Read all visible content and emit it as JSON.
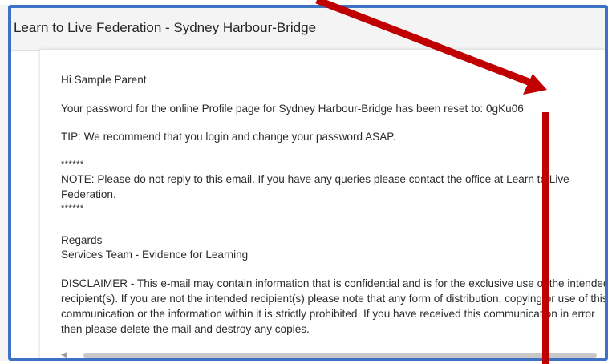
{
  "header": {
    "title": "Learn to Live Federation - Sydney Harbour-Bridge"
  },
  "email": {
    "greeting": "Hi Sample Parent",
    "password_line": "Your password for the online Profile page for Sydney Harbour-Bridge has been reset to: 0gKu06",
    "tip": "TIP: We recommend that you login and change your password ASAP.",
    "stars_top": "******",
    "note": "NOTE: Please do not reply to this email. If you have any queries please contact the office at Learn to Live Federation.",
    "stars_bottom": "******",
    "regards": "Regards",
    "signature": "Services Team - Evidence for Learning",
    "disclaimer": "DISCLAIMER - This e-mail may contain information that is confidential and is for the exclusive use of the intended recipient(s). If you are not the intended recipient(s) please note that any form of distribution, copying or use of this communication or the information within it is strictly prohibited. If you have received this communication in error then please delete the mail and destroy any copies."
  },
  "annotation": {
    "arrow_color": "#c00000",
    "frame_color": "#3d73c4"
  }
}
